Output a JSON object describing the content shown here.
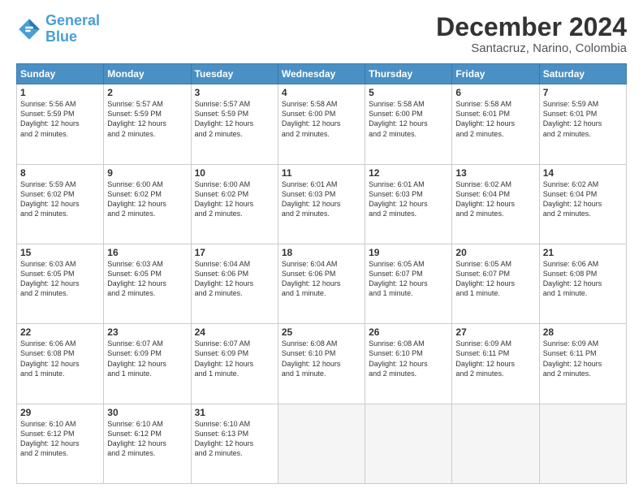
{
  "logo": {
    "line1": "General",
    "line2": "Blue"
  },
  "title": "December 2024",
  "subtitle": "Santacruz, Narino, Colombia",
  "days_header": [
    "Sunday",
    "Monday",
    "Tuesday",
    "Wednesday",
    "Thursday",
    "Friday",
    "Saturday"
  ],
  "weeks": [
    [
      {
        "day": 1,
        "info": "Sunrise: 5:56 AM\nSunset: 5:59 PM\nDaylight: 12 hours\nand 2 minutes."
      },
      {
        "day": 2,
        "info": "Sunrise: 5:57 AM\nSunset: 5:59 PM\nDaylight: 12 hours\nand 2 minutes."
      },
      {
        "day": 3,
        "info": "Sunrise: 5:57 AM\nSunset: 5:59 PM\nDaylight: 12 hours\nand 2 minutes."
      },
      {
        "day": 4,
        "info": "Sunrise: 5:58 AM\nSunset: 6:00 PM\nDaylight: 12 hours\nand 2 minutes."
      },
      {
        "day": 5,
        "info": "Sunrise: 5:58 AM\nSunset: 6:00 PM\nDaylight: 12 hours\nand 2 minutes."
      },
      {
        "day": 6,
        "info": "Sunrise: 5:58 AM\nSunset: 6:01 PM\nDaylight: 12 hours\nand 2 minutes."
      },
      {
        "day": 7,
        "info": "Sunrise: 5:59 AM\nSunset: 6:01 PM\nDaylight: 12 hours\nand 2 minutes."
      }
    ],
    [
      {
        "day": 8,
        "info": "Sunrise: 5:59 AM\nSunset: 6:02 PM\nDaylight: 12 hours\nand 2 minutes."
      },
      {
        "day": 9,
        "info": "Sunrise: 6:00 AM\nSunset: 6:02 PM\nDaylight: 12 hours\nand 2 minutes."
      },
      {
        "day": 10,
        "info": "Sunrise: 6:00 AM\nSunset: 6:02 PM\nDaylight: 12 hours\nand 2 minutes."
      },
      {
        "day": 11,
        "info": "Sunrise: 6:01 AM\nSunset: 6:03 PM\nDaylight: 12 hours\nand 2 minutes."
      },
      {
        "day": 12,
        "info": "Sunrise: 6:01 AM\nSunset: 6:03 PM\nDaylight: 12 hours\nand 2 minutes."
      },
      {
        "day": 13,
        "info": "Sunrise: 6:02 AM\nSunset: 6:04 PM\nDaylight: 12 hours\nand 2 minutes."
      },
      {
        "day": 14,
        "info": "Sunrise: 6:02 AM\nSunset: 6:04 PM\nDaylight: 12 hours\nand 2 minutes."
      }
    ],
    [
      {
        "day": 15,
        "info": "Sunrise: 6:03 AM\nSunset: 6:05 PM\nDaylight: 12 hours\nand 2 minutes."
      },
      {
        "day": 16,
        "info": "Sunrise: 6:03 AM\nSunset: 6:05 PM\nDaylight: 12 hours\nand 2 minutes."
      },
      {
        "day": 17,
        "info": "Sunrise: 6:04 AM\nSunset: 6:06 PM\nDaylight: 12 hours\nand 2 minutes."
      },
      {
        "day": 18,
        "info": "Sunrise: 6:04 AM\nSunset: 6:06 PM\nDaylight: 12 hours\nand 1 minute."
      },
      {
        "day": 19,
        "info": "Sunrise: 6:05 AM\nSunset: 6:07 PM\nDaylight: 12 hours\nand 1 minute."
      },
      {
        "day": 20,
        "info": "Sunrise: 6:05 AM\nSunset: 6:07 PM\nDaylight: 12 hours\nand 1 minute."
      },
      {
        "day": 21,
        "info": "Sunrise: 6:06 AM\nSunset: 6:08 PM\nDaylight: 12 hours\nand 1 minute."
      }
    ],
    [
      {
        "day": 22,
        "info": "Sunrise: 6:06 AM\nSunset: 6:08 PM\nDaylight: 12 hours\nand 1 minute."
      },
      {
        "day": 23,
        "info": "Sunrise: 6:07 AM\nSunset: 6:09 PM\nDaylight: 12 hours\nand 1 minute."
      },
      {
        "day": 24,
        "info": "Sunrise: 6:07 AM\nSunset: 6:09 PM\nDaylight: 12 hours\nand 1 minute."
      },
      {
        "day": 25,
        "info": "Sunrise: 6:08 AM\nSunset: 6:10 PM\nDaylight: 12 hours\nand 1 minute."
      },
      {
        "day": 26,
        "info": "Sunrise: 6:08 AM\nSunset: 6:10 PM\nDaylight: 12 hours\nand 2 minutes."
      },
      {
        "day": 27,
        "info": "Sunrise: 6:09 AM\nSunset: 6:11 PM\nDaylight: 12 hours\nand 2 minutes."
      },
      {
        "day": 28,
        "info": "Sunrise: 6:09 AM\nSunset: 6:11 PM\nDaylight: 12 hours\nand 2 minutes."
      }
    ],
    [
      {
        "day": 29,
        "info": "Sunrise: 6:10 AM\nSunset: 6:12 PM\nDaylight: 12 hours\nand 2 minutes."
      },
      {
        "day": 30,
        "info": "Sunrise: 6:10 AM\nSunset: 6:12 PM\nDaylight: 12 hours\nand 2 minutes."
      },
      {
        "day": 31,
        "info": "Sunrise: 6:10 AM\nSunset: 6:13 PM\nDaylight: 12 hours\nand 2 minutes."
      },
      null,
      null,
      null,
      null
    ]
  ]
}
